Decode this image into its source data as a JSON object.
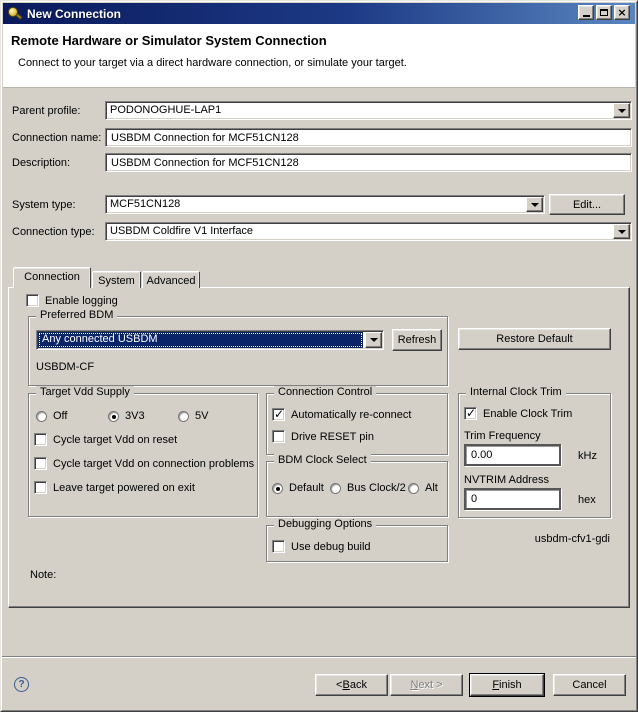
{
  "window": {
    "title": "New Connection"
  },
  "titlebar_buttons": {
    "minimize": "minimize",
    "maximize": "maximize",
    "close": "×"
  },
  "header": {
    "title": "Remote Hardware or Simulator System Connection",
    "subtitle": "Connect to your target via a direct hardware connection, or simulate your target."
  },
  "form": {
    "parent_profile": {
      "label": "Parent profile:",
      "value": "PODONOGHUE-LAP1"
    },
    "connection_name": {
      "label": "Connection name:",
      "value": "USBDM Connection for MCF51CN128"
    },
    "description": {
      "label": "Description:",
      "value": "USBDM Connection for MCF51CN128"
    },
    "system_type": {
      "label": "System type:",
      "value": "MCF51CN128",
      "edit_button": "Edit..."
    },
    "connection_type": {
      "label": "Connection type:",
      "value": "USBDM Coldfire V1 Interface"
    }
  },
  "tabs": [
    {
      "label": "Connection",
      "active": true
    },
    {
      "label": "System",
      "active": false
    },
    {
      "label": "Advanced",
      "active": false
    }
  ],
  "connection_tab": {
    "enable_logging": {
      "label": "Enable logging",
      "checked": false
    },
    "preferred_bdm": {
      "title": "Preferred BDM",
      "selected": "Any connected USBDM",
      "refresh_button": "Refresh",
      "device": "USBDM-CF"
    },
    "restore_default_button": "Restore Default",
    "target_vdd": {
      "title": "Target Vdd Supply",
      "radios": [
        {
          "label": "Off",
          "selected": false
        },
        {
          "label": "3V3",
          "selected": true
        },
        {
          "label": "5V",
          "selected": false
        }
      ],
      "checkboxes": [
        {
          "label": "Cycle target Vdd on reset",
          "checked": false
        },
        {
          "label": "Cycle target Vdd on connection problems",
          "checked": false
        },
        {
          "label": "Leave target powered on exit",
          "checked": false
        }
      ]
    },
    "connection_control": {
      "title": "Connection Control",
      "checkboxes": [
        {
          "label": "Automatically re-connect",
          "checked": true
        },
        {
          "label": "Drive RESET pin",
          "checked": false
        }
      ]
    },
    "bdm_clock": {
      "title": "BDM Clock Select",
      "radios": [
        {
          "label": "Default",
          "selected": true
        },
        {
          "label": "Bus Clock/2",
          "selected": false
        },
        {
          "label": "Alt",
          "selected": false
        }
      ]
    },
    "debugging": {
      "title": "Debugging Options",
      "checkboxes": [
        {
          "label": "Use debug build",
          "checked": false
        }
      ]
    },
    "clock_trim": {
      "title": "Internal Clock Trim",
      "enable": {
        "label": "Enable Clock Trim",
        "checked": true
      },
      "trim_frequency": {
        "label": "Trim Frequency",
        "value": "0.00",
        "unit": "kHz"
      },
      "nvtrim": {
        "label": "NVTRIM Address",
        "value": "0",
        "unit": "hex"
      }
    },
    "gdi_label": "usbdm-cfv1-gdi",
    "note_label": "Note:"
  },
  "footer": {
    "help": "?",
    "buttons": [
      {
        "label": "< Back",
        "mnemonic": "B",
        "disabled": false,
        "default": false
      },
      {
        "label": "Next >",
        "mnemonic": "N",
        "disabled": true,
        "default": false
      },
      {
        "label": "Finish",
        "mnemonic": "F",
        "disabled": false,
        "default": true
      },
      {
        "label": "Cancel",
        "mnemonic": "",
        "disabled": false,
        "default": false
      }
    ]
  },
  "colors": {
    "dialog_bg": "#d4d0c8",
    "titlebar_gradient_start": "#0a1a5c",
    "titlebar_gradient_end": "#5a86c0",
    "selection_bg": "#0a246a",
    "selection_fg": "#ffffff"
  }
}
